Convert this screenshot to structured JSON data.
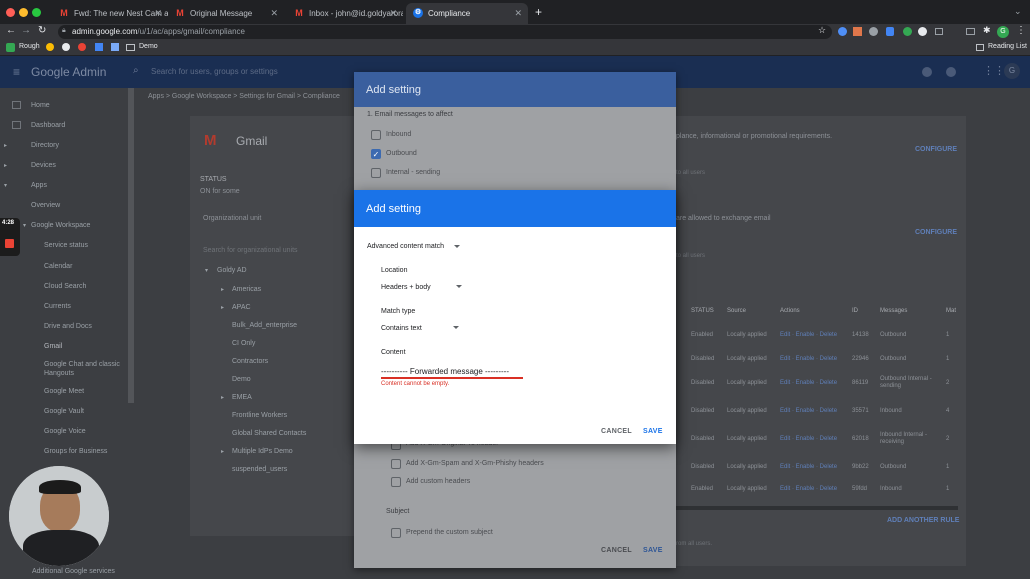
{
  "browser": {
    "tabs": [
      {
        "title": "Fwd: The new Nest Cam and N",
        "icon": "gmail-icon"
      },
      {
        "title": "Original Message",
        "icon": "gmail-icon"
      },
      {
        "title": "Inbox - john@id.goldyarora.co",
        "icon": "gmail-icon"
      },
      {
        "title": "Compliance",
        "icon": "admin-icon"
      }
    ],
    "url_host": "admin.google.com",
    "url_path": "/u/1/ac/apps/gmail/compliance",
    "bookmarks": [
      "Rough",
      "Demo"
    ],
    "reading_list": "Reading List",
    "profile_initial": "G"
  },
  "admin": {
    "brand": "Google Admin",
    "search_placeholder": "Search for users, groups or settings",
    "breadcrumb": "Apps > Google Workspace > Settings for Gmail > Compliance",
    "nav": [
      "Home",
      "Dashboard",
      "Directory",
      "Devices",
      "Apps",
      "Overview",
      "Google Workspace",
      "Service status",
      "Calendar",
      "Cloud Search",
      "Currents",
      "Drive and Docs",
      "Gmail",
      "Google Chat and classic Hangouts",
      "Google Meet",
      "Google Vault",
      "Google Voice",
      "Groups for Business",
      "Additional Google services"
    ],
    "app_title": "Gmail",
    "status_label": "STATUS",
    "status_value": "ON for some",
    "org_unit_label": "Organizational unit",
    "org_search_placeholder": "Search for organizational units",
    "org_units": [
      "Goldy AD",
      "Americas",
      "APAC",
      "Bulk_Add_enterprise",
      "CI Only",
      "Contractors",
      "Demo",
      "EMEA",
      "Frontline Workers",
      "Global Shared Contacts",
      "Multiple IdPs Demo",
      "suspended_users"
    ],
    "right_texts": {
      "desc1": "plance, informational or promotional requirements.",
      "configure": "CONFIGURE",
      "applies1": "to all users",
      "desc2": "are allowed to exchange email",
      "applies2": "to all users",
      "add_rule": "ADD ANOTHER RULE",
      "applies3": "rom all users."
    },
    "table": {
      "headers": [
        "STATUS",
        "Source",
        "Actions",
        "ID",
        "Messages",
        "Mat"
      ],
      "rows": [
        {
          "status": "Enabled",
          "source": "Locally applied",
          "actions": "Edit · Enable · Delete",
          "id": "14138",
          "messages": "Outbound",
          "mat": "1"
        },
        {
          "status": "Disabled",
          "source": "Locally applied",
          "actions": "Edit · Enable · Delete",
          "id": "22946",
          "messages": "Outbound",
          "mat": "1"
        },
        {
          "status": "Disabled",
          "source": "Locally applied",
          "actions": "Edit · Enable · Delete",
          "id": "86119",
          "messages": "Outbound Internal - sending",
          "mat": "2"
        },
        {
          "status": "Disabled",
          "source": "Locally applied",
          "actions": "Edit · Enable · Delete",
          "id": "35571",
          "messages": "Inbound",
          "mat": "4"
        },
        {
          "status": "Disabled",
          "source": "Locally applied",
          "actions": "Edit · Enable · Delete",
          "id": "62018",
          "messages": "Inbound Internal - receiving",
          "mat": "2"
        },
        {
          "status": "Disabled",
          "source": "Locally applied",
          "actions": "Edit · Enable · Delete",
          "id": "9bb22",
          "messages": "Outbound",
          "mat": "1"
        },
        {
          "status": "Enabled",
          "source": "Locally applied",
          "actions": "Edit · Enable · Delete",
          "id": "59fdd",
          "messages": "Inbound",
          "mat": "1"
        }
      ]
    }
  },
  "back_dialog": {
    "title": "Add setting",
    "section": "1. Email messages to affect",
    "options": [
      {
        "label": "Inbound",
        "checked": false
      },
      {
        "label": "Outbound",
        "checked": true
      },
      {
        "label": "Internal - sending",
        "checked": false
      }
    ],
    "lower_options": [
      "Add X-Gm-Original-To header",
      "Add X-Gm-Spam and X-Gm-Phishy headers",
      "Add custom headers"
    ],
    "subject_label": "Subject",
    "subject_option": "Prepend the custom subject",
    "cancel": "CANCEL",
    "save": "SAVE"
  },
  "front_dialog": {
    "title": "Add setting",
    "type_value": "Advanced content match",
    "location_label": "Location",
    "location_value": "Headers + body",
    "match_label": "Match type",
    "match_value": "Contains text",
    "content_label": "Content",
    "content_value": "---------- Forwarded message ---------",
    "error": "Content cannot be empty.",
    "cancel": "CANCEL",
    "save": "SAVE"
  },
  "recording": {
    "timer": "4:28"
  },
  "colors": {
    "accent": "#1a73e8",
    "error": "#d93025",
    "admin_bar": "#1a2e52"
  }
}
